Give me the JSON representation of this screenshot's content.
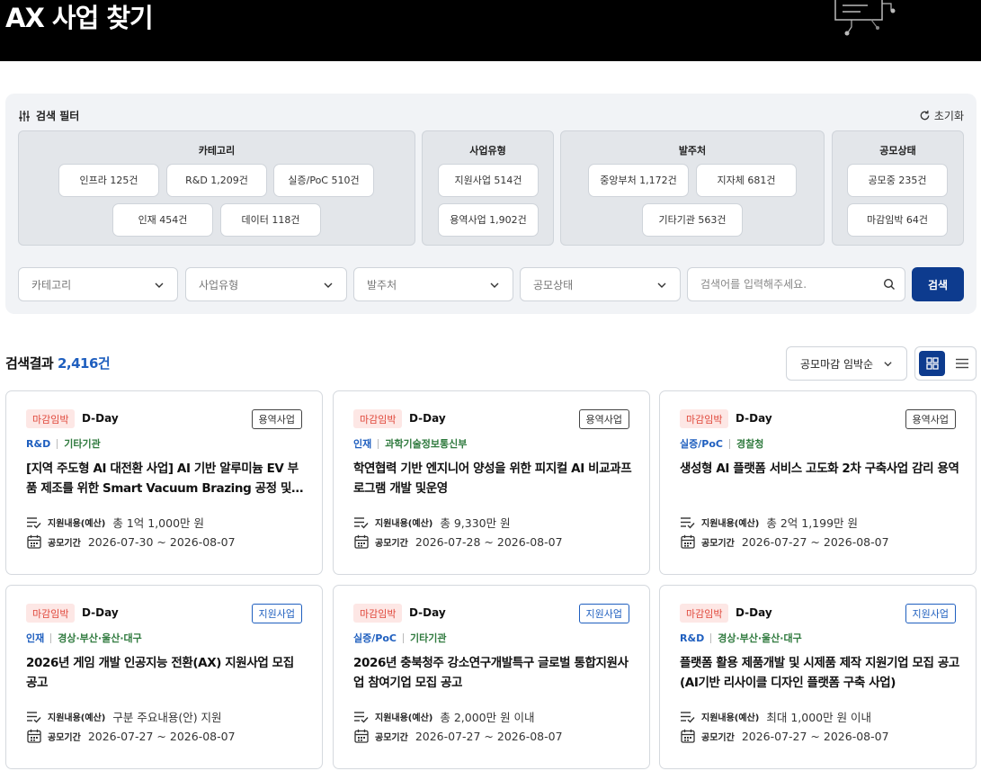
{
  "header": {
    "title": "AX 사업 찾기"
  },
  "filter": {
    "title": "검색 필터",
    "reset_label": "초기화",
    "groups": [
      {
        "title": "카테고리",
        "chips": [
          "인프라 125건",
          "R&D 1,209건",
          "실증/PoC 510건",
          "인재 454건",
          "데이터 118건"
        ]
      },
      {
        "title": "사업유형",
        "chips": [
          "지원사업 514건",
          "용역사업 1,902건"
        ]
      },
      {
        "title": "발주처",
        "chips": [
          "중앙부처 1,172건",
          "지자체 681건",
          "기타기관 563건"
        ]
      },
      {
        "title": "공모상태",
        "chips": [
          "공모중 235건",
          "마감임박 64건"
        ]
      }
    ],
    "selects": [
      "카테고리",
      "사업유형",
      "발주처",
      "공모상태"
    ],
    "search_placeholder": "검색어를 입력해주세요.",
    "search_button": "검색"
  },
  "results": {
    "label": "검색결과",
    "count": "2,416건",
    "sort_label": "공모마감 임박순"
  },
  "card_labels": {
    "budget": "지원내용(예산)",
    "period": "공모기간"
  },
  "cards": [
    {
      "deadline": "마감임박",
      "dday": "D-Day",
      "type": "용역사업",
      "category": "R&D",
      "org": "기타기관",
      "title": "[지역 주도형 AI 대전환 사업] AI 기반 알루미늄 EV 부품 제조를 위한 Smart Vacuum Brazing 공정 및 품질 관리 시스템 구축",
      "budget": "총 1억 1,000만 원",
      "period": "2026-07-30 ~ 2026-08-07"
    },
    {
      "deadline": "마감임박",
      "dday": "D-Day",
      "type": "용역사업",
      "category": "인재",
      "org": "과학기술정보통신부",
      "title": "학연협력 기반 엔지니어 양성을 위한 피지컬 AI 비교과프로그램 개발 및운영",
      "budget": "총 9,330만 원",
      "period": "2026-07-28 ~ 2026-08-07"
    },
    {
      "deadline": "마감임박",
      "dday": "D-Day",
      "type": "용역사업",
      "category": "실증/PoC",
      "org": "경찰청",
      "title": "생성형 AI 플랫폼 서비스 고도화 2차 구축사업 감리 용역",
      "budget": "총 2억 1,199만 원",
      "period": "2026-07-27 ~ 2026-08-07"
    },
    {
      "deadline": "마감임박",
      "dday": "D-Day",
      "type": "지원사업",
      "category": "인재",
      "org": "경상·부산·울산·대구",
      "title": "2026년 게임 개발 인공지능 전환(AX) 지원사업 모집 공고",
      "budget": "구분 주요내용(안) 지원",
      "period": "2026-07-27 ~ 2026-08-07"
    },
    {
      "deadline": "마감임박",
      "dday": "D-Day",
      "type": "지원사업",
      "category": "실증/PoC",
      "org": "기타기관",
      "title": "2026년 충북청주 강소연구개발특구 글로벌 통합지원사업 참여기업 모집 공고",
      "budget": "총 2,000만 원 이내",
      "period": "2026-07-27 ~ 2026-08-07"
    },
    {
      "deadline": "마감임박",
      "dday": "D-Day",
      "type": "지원사업",
      "category": "R&D",
      "org": "경상·부산·울산·대구",
      "title": "플랫폼 활용 제품개발 및 시제품 제작 지원기업 모집 공고(AI기반 리사이클 디자인 플랫폼 구축 사업)",
      "budget": "최대 1,000만 원 이내",
      "period": "2026-07-27 ~ 2026-08-07"
    }
  ]
}
